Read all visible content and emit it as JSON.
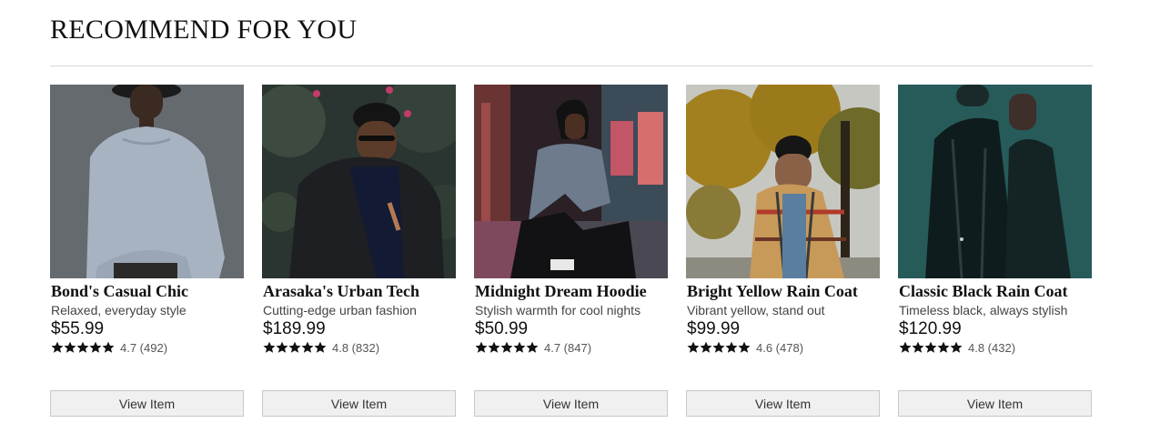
{
  "section": {
    "title": "RECOMMEND FOR YOU"
  },
  "products": [
    {
      "name": "Bond's Casual Chic",
      "description": "Relaxed, everyday style",
      "price": "$55.99",
      "rating_text": "4.7 (492)",
      "rating": 4.7,
      "button_label": "View Item",
      "image_icon": "product-photo"
    },
    {
      "name": "Arasaka's Urban Tech",
      "description": "Cutting-edge urban fashion",
      "price": "$189.99",
      "rating_text": "4.8 (832)",
      "rating": 4.8,
      "button_label": "View Item",
      "image_icon": "product-photo"
    },
    {
      "name": "Midnight Dream Hoodie",
      "description": "Stylish warmth for cool nights",
      "price": "$50.99",
      "rating_text": "4.7 (847)",
      "rating": 4.7,
      "button_label": "View Item",
      "image_icon": "product-photo"
    },
    {
      "name": "Bright Yellow Rain Coat",
      "description": "Vibrant yellow, stand out",
      "price": "$99.99",
      "rating_text": "4.6 (478)",
      "rating": 4.6,
      "button_label": "View Item",
      "image_icon": "product-photo"
    },
    {
      "name": "Classic Black Rain Coat",
      "description": "Timeless black, always stylish",
      "price": "$120.99",
      "rating_text": "4.8 (432)",
      "rating": 4.8,
      "button_label": "View Item",
      "image_icon": "product-photo"
    }
  ],
  "colors": {
    "star": "#111111",
    "button_bg": "#f0f0f0",
    "button_border": "#c8c8c8",
    "divider": "#d6d6d6"
  }
}
